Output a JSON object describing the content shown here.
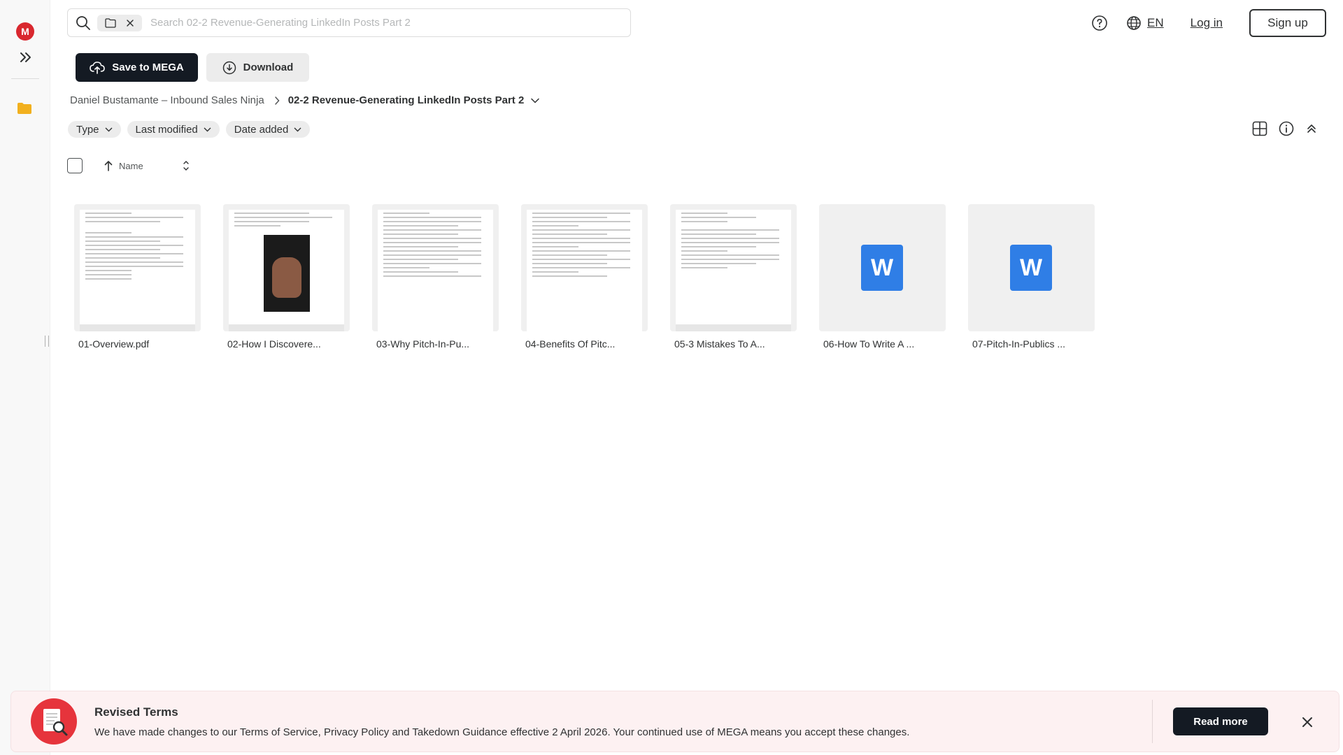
{
  "rail": {
    "logo_letter": "M"
  },
  "search": {
    "placeholder": "Search 02-2 Revenue-Generating LinkedIn Posts Part 2",
    "value": ""
  },
  "header": {
    "language": "EN",
    "login_label": "Log in",
    "signup_label": "Sign up"
  },
  "actions": {
    "save_label": "Save to MEGA",
    "download_label": "Download"
  },
  "breadcrumb": {
    "parent": "Daniel Bustamante – Inbound Sales Ninja",
    "current": "02-2 Revenue-Generating LinkedIn Posts Part 2"
  },
  "filters": {
    "type": "Type",
    "last_modified": "Last modified",
    "date_added": "Date added"
  },
  "list": {
    "name_header": "Name"
  },
  "files": [
    {
      "name": "01-Overview.pdf",
      "kind": "pdf"
    },
    {
      "name": "02-How I Discovere...",
      "kind": "pdf-photo"
    },
    {
      "name": "03-Why Pitch-In-Pu...",
      "kind": "pdf"
    },
    {
      "name": "04-Benefits Of Pitc...",
      "kind": "pdf"
    },
    {
      "name": "05-3 Mistakes To A...",
      "kind": "pdf"
    },
    {
      "name": "06-How To Write A ...",
      "kind": "word",
      "icon_letter": "W"
    },
    {
      "name": "07-Pitch-In-Publics ...",
      "kind": "word",
      "icon_letter": "W"
    }
  ],
  "notice": {
    "title": "Revised Terms",
    "body": "We have made changes to our Terms of Service, Privacy Policy and Takedown Guidance effective 2 April 2026. Your continued use of MEGA means you accept these changes.",
    "read_more_label": "Read more"
  },
  "colors": {
    "brand_red": "#d9272e",
    "dark_button": "#141a23",
    "word_blue": "#2f7ee6",
    "folder_yellow": "#f2b01e"
  }
}
